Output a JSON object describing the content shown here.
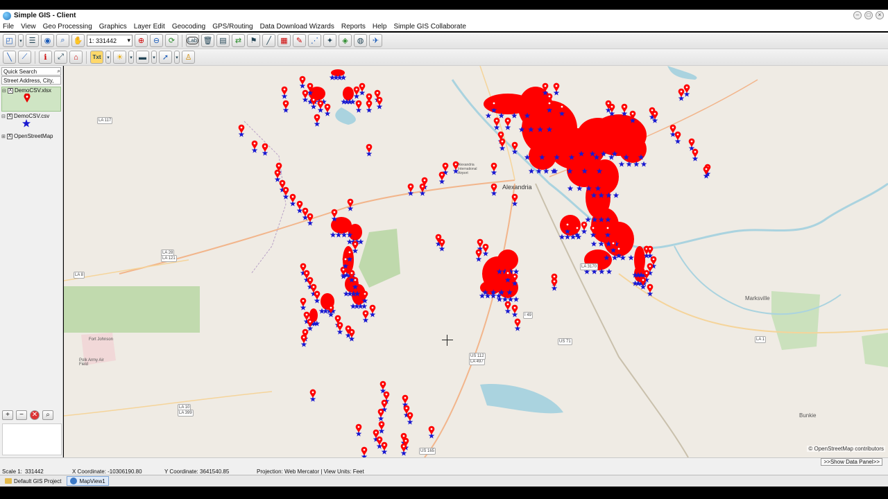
{
  "window": {
    "title": "Simple GIS - Client"
  },
  "menu": [
    "File",
    "View",
    "Geo Processing",
    "Graphics",
    "Layer Edit",
    "Geocoding",
    "GPS/Routing",
    "Data Download Wizards",
    "Reports",
    "Help",
    "Simple GIS Collaborate"
  ],
  "toolbar": {
    "scale_value": "1: 331442",
    "text_tool": "Txt",
    "label_tool": "Lab"
  },
  "sidebar": {
    "quick_search_label": "Quick Search",
    "address_placeholder": "Street Address, City,",
    "layers": [
      {
        "name": "DemoCSV.xlsx",
        "checked": "X",
        "symbol": "red-pin"
      },
      {
        "name": "DemoCSV.csv",
        "checked": "X",
        "symbol": "blue-star"
      },
      {
        "name": "OpenStreetMap",
        "checked": "X"
      }
    ],
    "buttons": {
      "add": "+",
      "remove": "−"
    }
  },
  "map": {
    "attribution": "© OpenStreetMap contributors",
    "place_labels": [
      "Alexandria",
      "Marksville",
      "Bunkie",
      "Fort Johnson",
      "Polk Army Air Field",
      "Alexandria International Airport"
    ],
    "road_labels": [
      "LA 117",
      "LA 28",
      "LA 121",
      "LA 8",
      "LA 10",
      "LA 399",
      "US 165",
      "US 71",
      "LA 1",
      "LA 3170",
      "LA 497",
      "US 112",
      "I 49"
    ]
  },
  "status": {
    "scale_label": "Scale 1:",
    "scale_value": "331442",
    "x_coord": "X Coordinate: -10306190.80",
    "y_coord": "Y Coordinate: 3641540.85",
    "projection": "Projection: Web Mercator | View Units: Feet",
    "show_data_panel": ">>Show Data Panel>>"
  },
  "tabs": [
    "Default GIS Project",
    "MapView1"
  ],
  "colors": {
    "pin": "#ff0000",
    "star": "#1a1ad0",
    "water": "#aad3df",
    "park": "#b9d7a5"
  }
}
